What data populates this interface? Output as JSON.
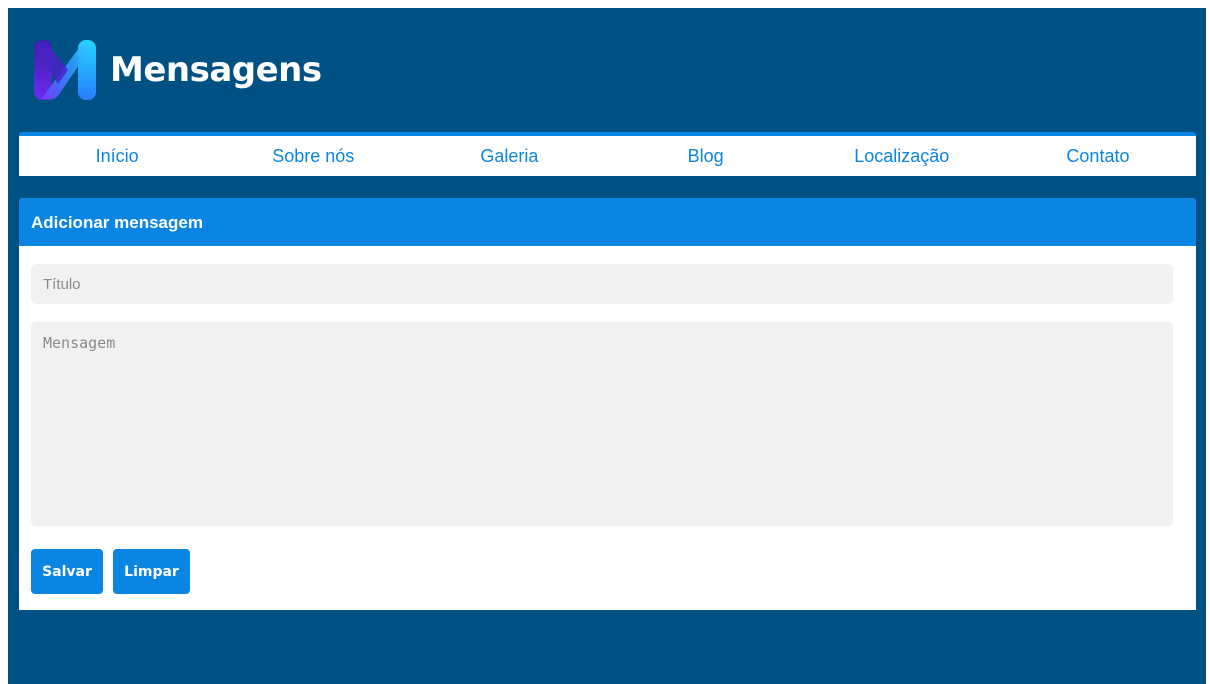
{
  "header": {
    "title": "Mensagens",
    "logo_icon": "m-logo-icon"
  },
  "nav": {
    "items": [
      {
        "label": "Início"
      },
      {
        "label": "Sobre nós"
      },
      {
        "label": "Galeria"
      },
      {
        "label": "Blog"
      },
      {
        "label": "Localização"
      },
      {
        "label": "Contato"
      }
    ]
  },
  "form": {
    "heading": "Adicionar mensagem",
    "title_field": {
      "value": "",
      "placeholder": "Título"
    },
    "message_field": {
      "value": "",
      "placeholder": "Mensagem"
    },
    "save_label": "Salvar",
    "clear_label": "Limpar"
  },
  "colors": {
    "background": "#005183",
    "accent": "#0a85e2",
    "field_bg": "#f1f1f1"
  }
}
